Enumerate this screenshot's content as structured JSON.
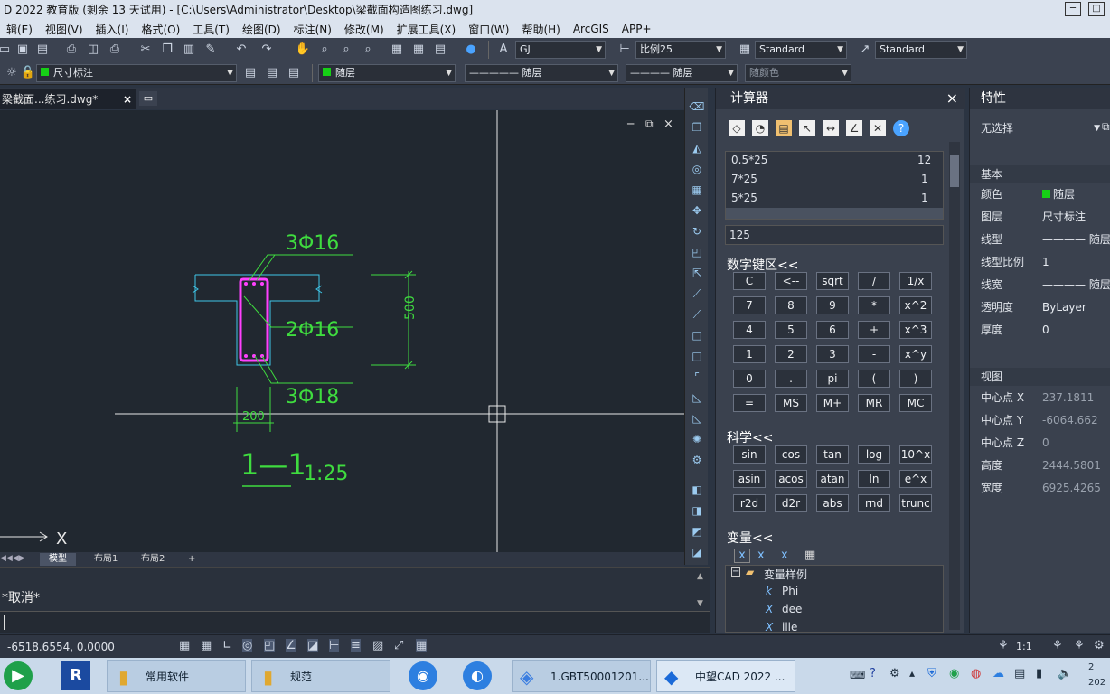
{
  "window": {
    "title": "D 2022 教育版 (剩余 13 天试用) - [C:\\Users\\Administrator\\Desktop\\梁截面构造图练习.dwg]",
    "min": "─",
    "max": "□"
  },
  "menu": [
    "辑(E)",
    "视图(V)",
    "插入(I)",
    "格式(O)",
    "工具(T)",
    "绘图(D)",
    "标注(N)",
    "修改(M)",
    "扩展工具(X)",
    "窗口(W)",
    "帮助(H)",
    "ArcGIS",
    "APP+"
  ],
  "toolbar1": {
    "text_style": "GJ",
    "dim_style": "比例25",
    "table_style": "Standard",
    "multileader_style": "Standard"
  },
  "toolbar2": {
    "layer": "尺寸标注",
    "color": "随层",
    "linetype": "————— 随层",
    "lineweight": "———— 随层",
    "plotstyle": "随颜色"
  },
  "doc_tab": {
    "label": "梁截面...练习.dwg*",
    "close": "×"
  },
  "viewport_controls": {
    "min": "─",
    "restore": "⧉",
    "close": "×"
  },
  "drawing": {
    "label_top": "3Φ16",
    "label_mid": "2Φ16",
    "label_bot": "3Φ18",
    "dim_height": "500",
    "dim_width": "200",
    "section_label": "1—1",
    "scale_label": "1:25",
    "axis_x": "X",
    "colors": {
      "outline": "#3fc6e8",
      "rebar": "#ff40ff",
      "text": "#3fdc3f",
      "crosshair": "#e8e8e8"
    }
  },
  "layout_tabs": [
    "模型",
    "布局1",
    "布局2",
    "+"
  ],
  "command": {
    "history": "*取消*",
    "prompt": ""
  },
  "calculator": {
    "title": "计算器",
    "close": "×",
    "history": [
      {
        "expr": "0.5*25",
        "result": "12"
      },
      {
        "expr": "7*25",
        "result": "1"
      },
      {
        "expr": "5*25",
        "result": "1"
      }
    ],
    "input": "125",
    "numpad_title": "数字键区<<",
    "numpad": [
      [
        "C",
        "<--",
        "sqrt",
        "/",
        "1/x"
      ],
      [
        "7",
        "8",
        "9",
        "*",
        "x^2"
      ],
      [
        "4",
        "5",
        "6",
        "+",
        "x^3"
      ],
      [
        "1",
        "2",
        "3",
        "-",
        "x^y"
      ],
      [
        "0",
        ".",
        "pi",
        "(",
        ")"
      ],
      [
        "=",
        "MS",
        "M+",
        "MR",
        "MC"
      ]
    ],
    "science_title": "科学<<",
    "science": [
      [
        "sin",
        "cos",
        "tan",
        "log",
        "10^x"
      ],
      [
        "asin",
        "acos",
        "atan",
        "ln",
        "e^x"
      ],
      [
        "r2d",
        "d2r",
        "abs",
        "rnd",
        "trunc"
      ]
    ],
    "variables_title": "变量<<",
    "variables_folder": "变量样例",
    "variables": [
      {
        "sym": "k",
        "name": "Phi"
      },
      {
        "sym": "X",
        "name": "dee"
      },
      {
        "sym": "X",
        "name": "ille"
      }
    ]
  },
  "properties": {
    "title": "特性",
    "selection": "无选择",
    "basic_title": "基本",
    "basic": [
      {
        "key": "颜色",
        "value": "随层"
      },
      {
        "key": "图层",
        "value": "尺寸标注"
      },
      {
        "key": "线型",
        "value": "———— 随层"
      },
      {
        "key": "线型比例",
        "value": "1"
      },
      {
        "key": "线宽",
        "value": "———— 随层"
      },
      {
        "key": "透明度",
        "value": "ByLayer"
      },
      {
        "key": "厚度",
        "value": "0"
      }
    ],
    "view_title": "视图",
    "view": [
      {
        "key": "中心点 X",
        "value": "237.1811"
      },
      {
        "key": "中心点 Y",
        "value": "-6064.662"
      },
      {
        "key": "中心点 Z",
        "value": "0"
      },
      {
        "key": "高度",
        "value": "2444.5801"
      },
      {
        "key": "宽度",
        "value": "6925.4265"
      }
    ]
  },
  "status": {
    "coords": "-6518.6554, 0.0000",
    "annot_scale": "1:1"
  },
  "taskbar": {
    "tasks": [
      "常用软件",
      "规范",
      "1.GBT50001201...",
      "中望CAD 2022 ..."
    ],
    "clock": "2\n202"
  }
}
